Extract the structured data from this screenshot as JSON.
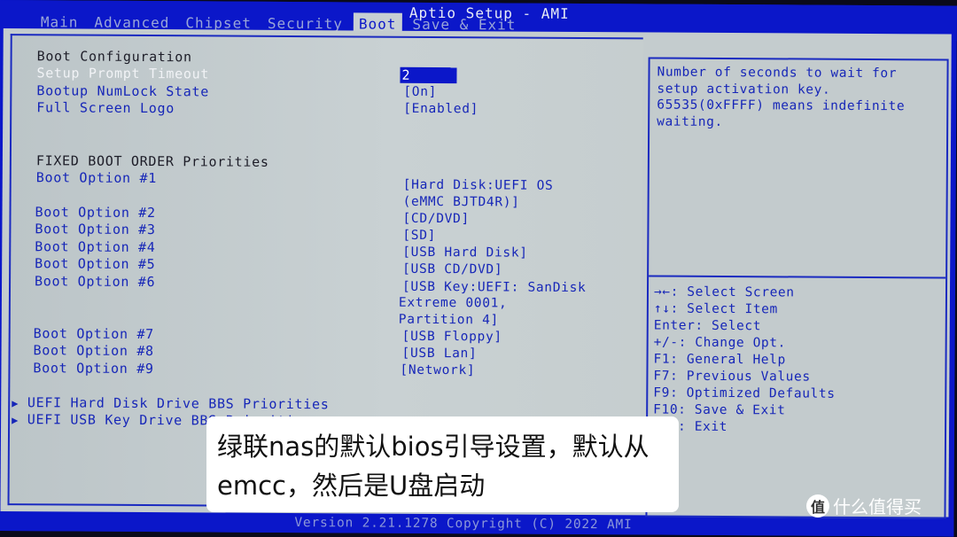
{
  "app_title": "Aptio Setup - AMI",
  "tabs": [
    {
      "label": "Main",
      "active": false
    },
    {
      "label": "Advanced",
      "active": false
    },
    {
      "label": "Chipset",
      "active": false
    },
    {
      "label": "Security",
      "active": false
    },
    {
      "label": "Boot",
      "active": true
    },
    {
      "label": "Save & Exit",
      "active": false
    }
  ],
  "main": {
    "boot_config_heading": "Boot Configuration",
    "settings": [
      {
        "label": "Setup Prompt Timeout",
        "value": "2",
        "selected": true
      },
      {
        "label": "Bootup NumLock State",
        "value": "[On]"
      },
      {
        "label": "Full Screen Logo",
        "value": "[Enabled]"
      }
    ],
    "fixed_boot_heading": "FIXED BOOT ORDER Priorities",
    "boot_options": [
      {
        "label": "Boot Option #1",
        "value_lines": [
          "[Hard Disk:UEFI OS",
          "(eMMC BJTD4R)]"
        ]
      },
      {
        "label": "Boot Option #2",
        "value_lines": [
          "[CD/DVD]"
        ]
      },
      {
        "label": "Boot Option #3",
        "value_lines": [
          "[SD]"
        ]
      },
      {
        "label": "Boot Option #4",
        "value_lines": [
          "[USB Hard Disk]"
        ]
      },
      {
        "label": "Boot Option #5",
        "value_lines": [
          "[USB CD/DVD]"
        ]
      },
      {
        "label": "Boot Option #6",
        "value_lines": [
          "[USB Key:UEFI: SanDisk",
          "Extreme 0001,",
          "Partition 4]"
        ]
      },
      {
        "label": "Boot Option #7",
        "value_lines": [
          "[USB Floppy]"
        ]
      },
      {
        "label": "Boot Option #8",
        "value_lines": [
          "[USB Lan]"
        ]
      },
      {
        "label": "Boot Option #9",
        "value_lines": [
          "[Network]"
        ]
      }
    ],
    "submenus": [
      {
        "label": "UEFI Hard Disk Drive BBS Priorities"
      },
      {
        "label": "UEFI USB Key Drive BBS Priorities"
      }
    ]
  },
  "help": {
    "text": "Number of seconds to wait for\nsetup activation key.\n65535(0xFFFF) means indefinite\nwaiting."
  },
  "keys": [
    "→←: Select Screen",
    "↑↓: Select Item",
    "Enter: Select",
    "+/-: Change Opt.",
    "F1: General Help",
    "F7: Previous Values",
    "F9: Optimized Defaults",
    "F10: Save & Exit",
    "ESC: Exit"
  ],
  "footer": {
    "version": "Version 2.21.1278 Copyright (C) 2022 AMI"
  },
  "caption": {
    "line1": "绿联nas的默认bios引导设置，默认从",
    "line2": "emcc，然后是U盘启动"
  },
  "watermark": {
    "icon_glyph": "值",
    "text": "什么值得买"
  }
}
